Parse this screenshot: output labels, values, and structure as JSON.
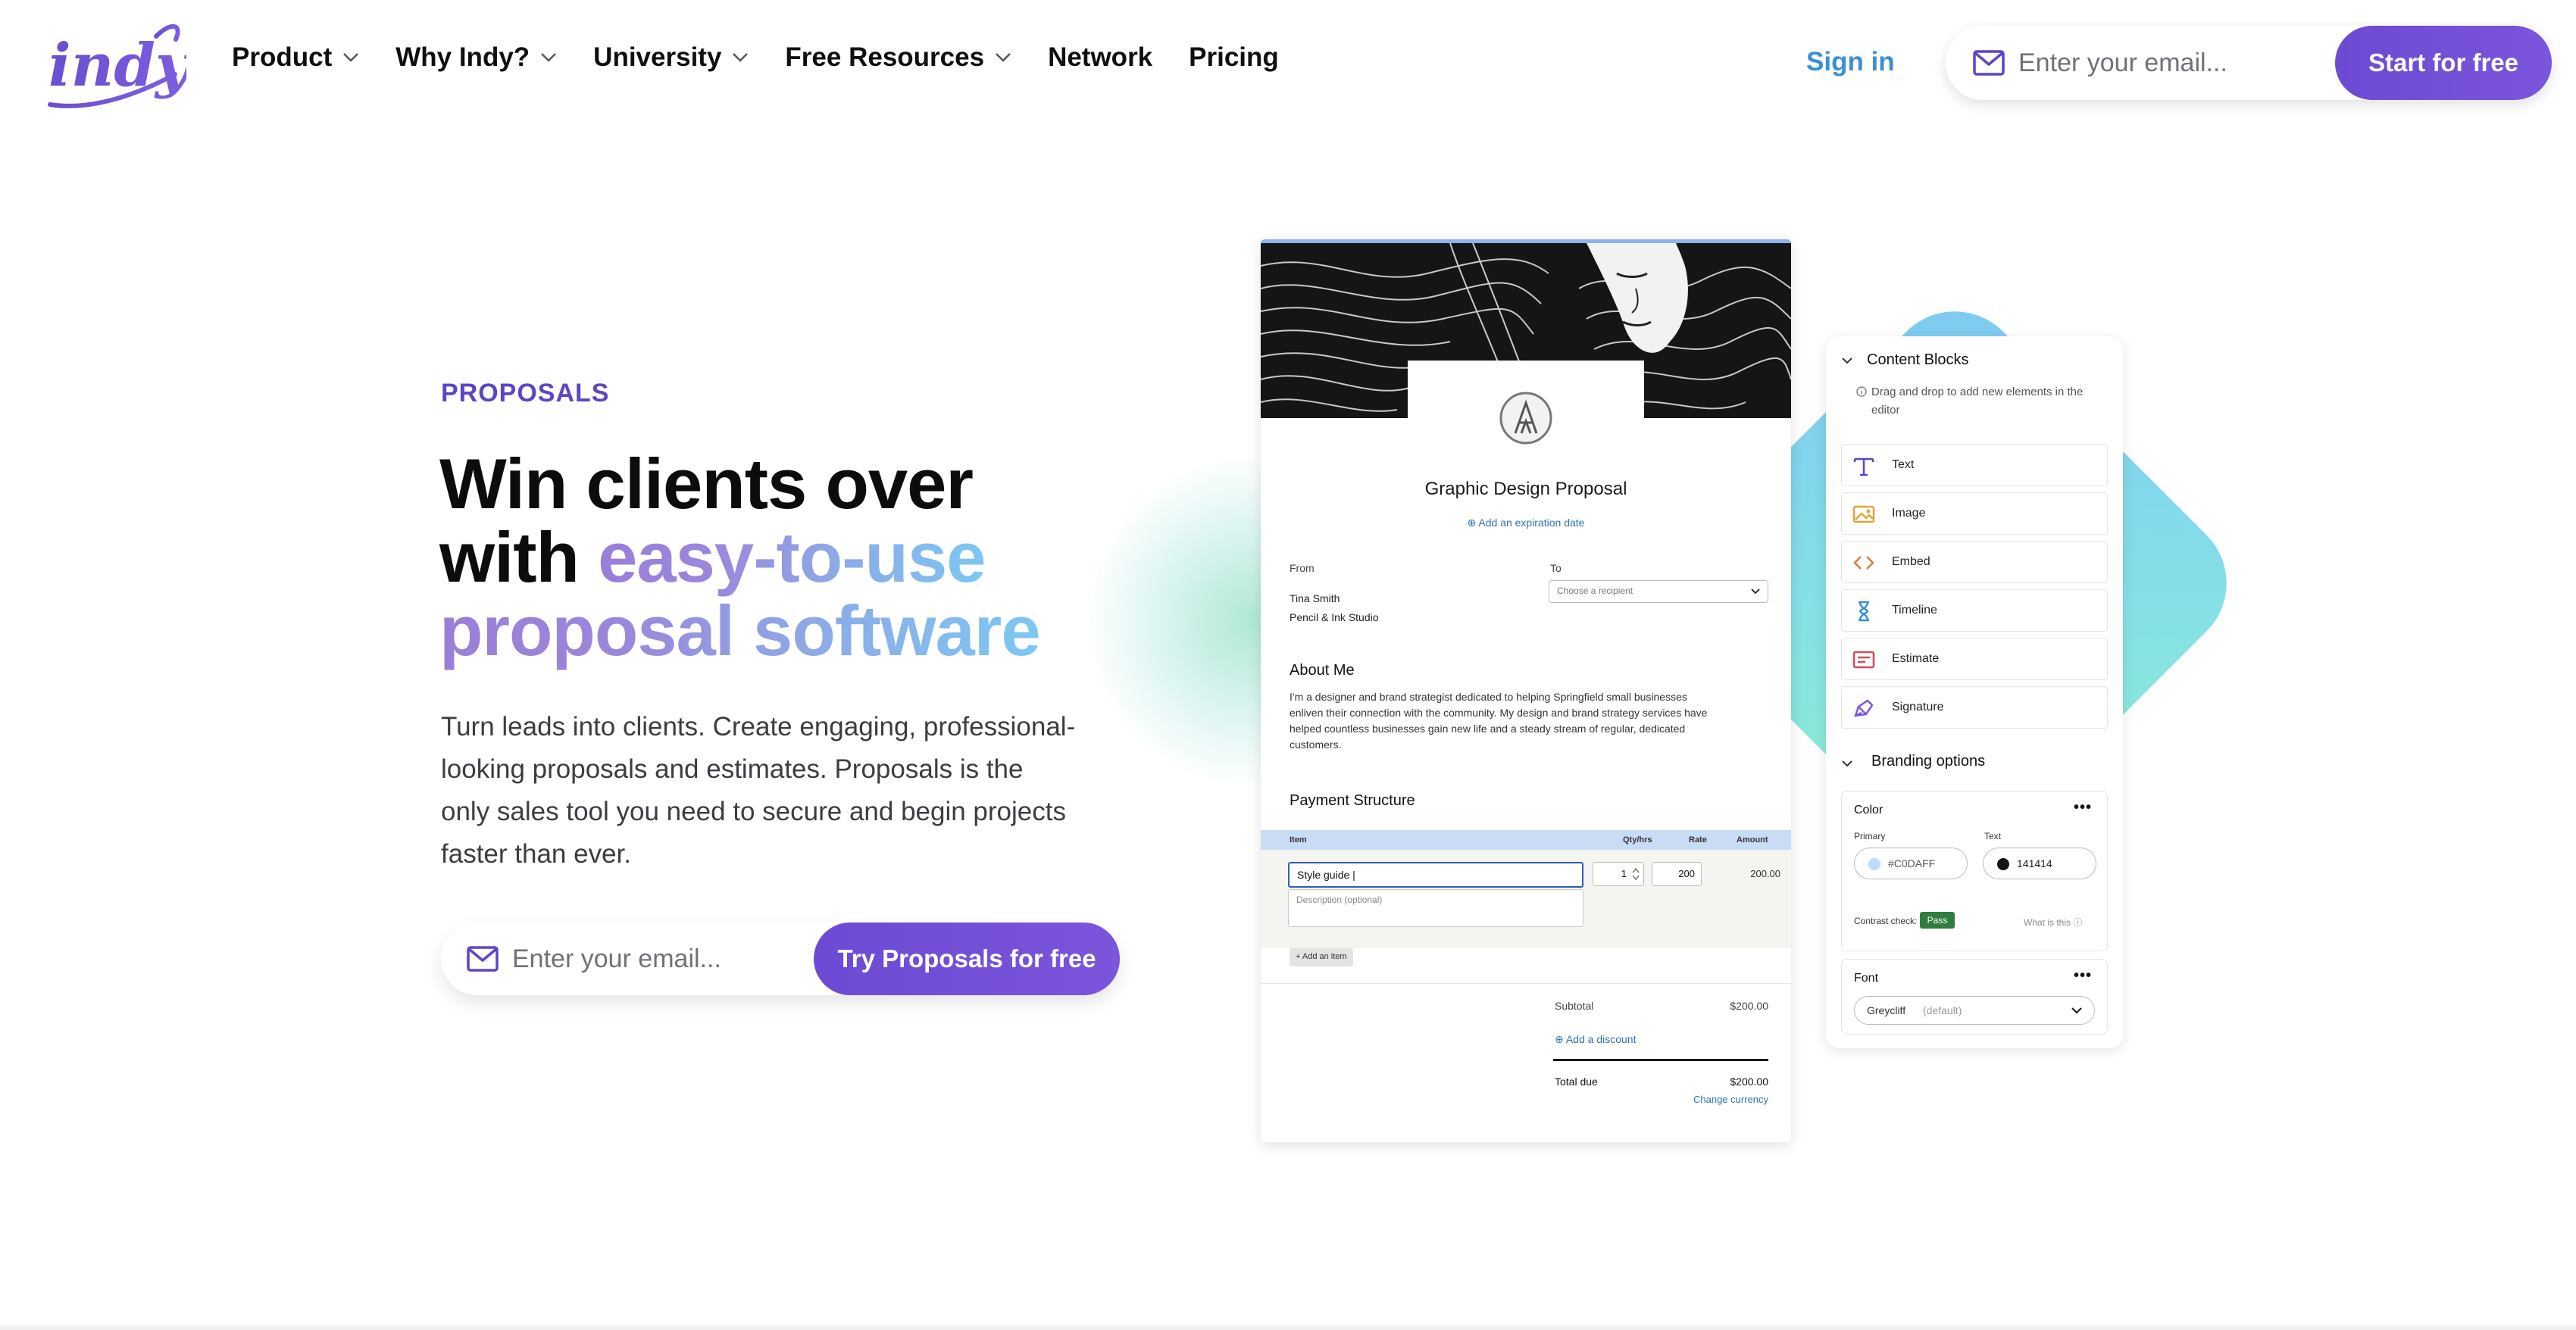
{
  "header": {
    "logo_text": "indy",
    "nav": [
      {
        "label": "Product",
        "has_dropdown": true
      },
      {
        "label": "Why Indy?",
        "has_dropdown": true
      },
      {
        "label": "University",
        "has_dropdown": true
      },
      {
        "label": "Free Resources",
        "has_dropdown": true
      },
      {
        "label": "Network",
        "has_dropdown": false
      },
      {
        "label": "Pricing",
        "has_dropdown": false
      }
    ],
    "signin_label": "Sign in",
    "email_placeholder": "Enter your email...",
    "cta_label": "Start for free"
  },
  "hero": {
    "eyebrow": "PROPOSALS",
    "headline_line1": "Win clients over",
    "headline_line2_plain": "with ",
    "headline_line2_gradient": "easy-to-use",
    "headline_line3_gradient": "proposal software",
    "subcopy": "Turn leads into clients. Create engaging, professional-looking proposals and estimates. Proposals is the only sales tool you need to secure and begin projects faster than ever.",
    "email_placeholder": "Enter your email...",
    "cta_label": "Try Proposals for free"
  },
  "proposal_doc": {
    "title": "Graphic Design Proposal",
    "expiration_link": "⊕ Add an expiration date",
    "from_label": "From",
    "to_label": "To",
    "from_name": "Tina Smith",
    "from_company": "Pencil & Ink Studio",
    "recipient_placeholder": "Choose a recipient",
    "about_heading": "About Me",
    "about_text": "I'm a designer and brand strategist dedicated to helping Springfield small businesses enliven their connection with the community. My design and brand strategy services have helped countless businesses gain new life and a steady stream of regular, dedicated customers.",
    "payment_heading": "Payment Structure",
    "table_headers": {
      "item": "Item",
      "qty": "Qty/hrs",
      "rate": "Rate",
      "amount": "Amount"
    },
    "row": {
      "item": "Style guide |",
      "description_placeholder": "Description (optional)",
      "qty": "1",
      "rate": "200",
      "amount": "200.00"
    },
    "add_item_label": "+ Add an item",
    "subtotal_label": "Subtotal",
    "subtotal_value": "$200.00",
    "discount_link": "⊕ Add a discount",
    "total_label": "Total due",
    "total_value": "$200.00",
    "currency_link": "Change currency"
  },
  "side_panel": {
    "content_blocks_heading": "Content Blocks",
    "drag_note": "Drag and drop to add new elements in the editor",
    "blocks": [
      {
        "label": "Text",
        "icon": "text-icon",
        "color": "#5a47c4"
      },
      {
        "label": "Image",
        "icon": "image-icon",
        "color": "#e0a53a"
      },
      {
        "label": "Embed",
        "icon": "embed-icon",
        "color": "#e07a3a"
      },
      {
        "label": "Timeline",
        "icon": "timeline-icon",
        "color": "#3a8fd6"
      },
      {
        "label": "Estimate",
        "icon": "estimate-icon",
        "color": "#d64a5a"
      },
      {
        "label": "Signature",
        "icon": "signature-icon",
        "color": "#7b55db"
      }
    ],
    "branding_heading": "Branding options",
    "color_label": "Color",
    "primary_label": "Primary",
    "primary_value": "#C0DAFF",
    "text_label": "Text",
    "text_value": "141414",
    "contrast_label": "Contrast check:",
    "contrast_status": "Pass",
    "what_is_this": "What is this ⓘ",
    "font_label": "Font",
    "font_value": "Greycliff",
    "font_default": "(default)"
  },
  "colors": {
    "brand_purple": "#6d4ad3",
    "signin_blue": "#3a8fd6",
    "primary_swatch": "#C0DAFF",
    "text_swatch": "#141414",
    "pass_green": "#2f7d3f"
  }
}
